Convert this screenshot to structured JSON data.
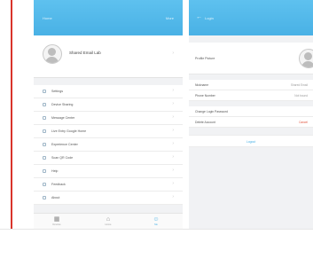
{
  "left_screen": {
    "header": {
      "title": "Home",
      "right_action": "More"
    },
    "profile": {
      "name": "Shared Email Lab"
    },
    "menu": [
      {
        "icon": "user-icon",
        "label": "Settings"
      },
      {
        "icon": "share-icon",
        "label": "Device Sharing"
      },
      {
        "icon": "message-icon",
        "label": "Message Center"
      },
      {
        "icon": "link-icon",
        "label": "Live Entry Google Home"
      },
      {
        "icon": "flask-icon",
        "label": "Experience Center"
      },
      {
        "icon": "scan-icon",
        "label": "Scan QR Code"
      },
      {
        "icon": "help-icon",
        "label": "Help"
      },
      {
        "icon": "feedback-icon",
        "label": "Feedback"
      },
      {
        "icon": "info-icon",
        "label": "About"
      }
    ],
    "tabbar": [
      {
        "icon": "device-icon",
        "label": "Devices",
        "active": false
      },
      {
        "icon": "home-icon",
        "label": "Home",
        "active": false
      },
      {
        "icon": "me-icon",
        "label": "Me",
        "active": true
      }
    ]
  },
  "right_screen": {
    "header": {
      "back_icon": "back-arrow-icon",
      "title": "Login"
    },
    "profile_picture_label": "Profile Picture",
    "rows": [
      {
        "key": "Nickname",
        "value": "Shared Email"
      },
      {
        "key": "Phone Number",
        "value": "Not bound"
      },
      {
        "key": "Change Login Password",
        "value": ""
      },
      {
        "key": "Delete Account",
        "value": "Cancel",
        "value_color": "#e0523c"
      }
    ],
    "logout_label": "Logout"
  },
  "colors": {
    "accent": "#49b1e5",
    "divider_red": "#d9342b"
  }
}
